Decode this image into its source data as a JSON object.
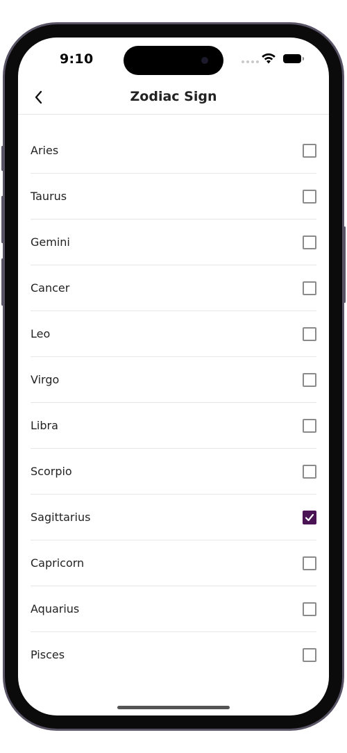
{
  "status_bar": {
    "time": "9:10"
  },
  "header": {
    "title": "Zodiac Sign",
    "back_icon": "chevron-left-icon"
  },
  "zodiac_options": [
    {
      "label": "Aries",
      "checked": false
    },
    {
      "label": "Taurus",
      "checked": false
    },
    {
      "label": "Gemini",
      "checked": false
    },
    {
      "label": "Cancer",
      "checked": false
    },
    {
      "label": "Leo",
      "checked": false
    },
    {
      "label": "Virgo",
      "checked": false
    },
    {
      "label": "Libra",
      "checked": false
    },
    {
      "label": "Scorpio",
      "checked": false
    },
    {
      "label": "Sagittarius",
      "checked": true
    },
    {
      "label": "Capricorn",
      "checked": false
    },
    {
      "label": "Aquarius",
      "checked": false
    },
    {
      "label": "Pisces",
      "checked": false
    }
  ],
  "colors": {
    "accent": "#4a1354",
    "checkbox_border": "#8a8a8a",
    "divider": "#e6e6e6"
  }
}
